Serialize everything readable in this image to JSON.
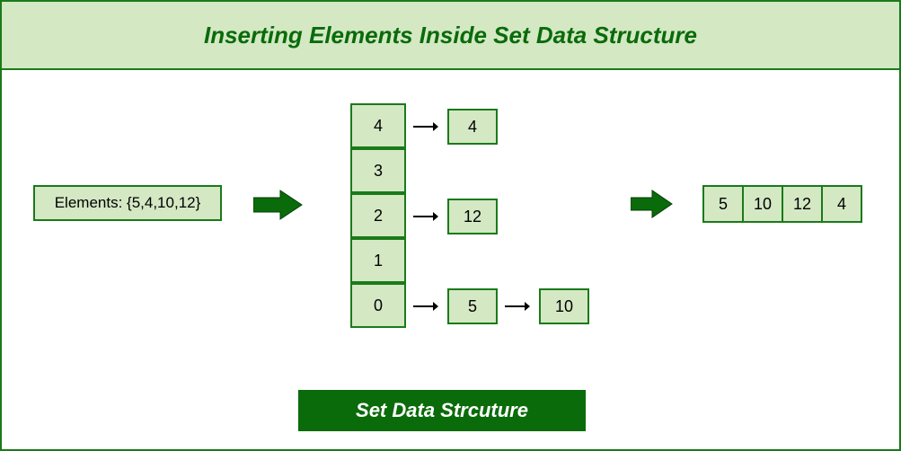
{
  "header": {
    "title": "Inserting Elements Inside Set Data Structure"
  },
  "input": {
    "label": "Elements: {5,4,10,12}"
  },
  "hash": {
    "buckets": [
      "4",
      "3",
      "2",
      "1",
      "0"
    ],
    "chains": {
      "0": [
        "4"
      ],
      "1": [],
      "2": [
        "12"
      ],
      "3": [],
      "4": [
        "5",
        "10"
      ]
    }
  },
  "result": {
    "values": [
      "5",
      "10",
      "12",
      "4"
    ]
  },
  "footer": {
    "label": "Set Data Strcuture"
  },
  "colors": {
    "dark_green": "#0a6b0a",
    "border_green": "#1a7a1a",
    "light_green": "#d4e8c4"
  }
}
